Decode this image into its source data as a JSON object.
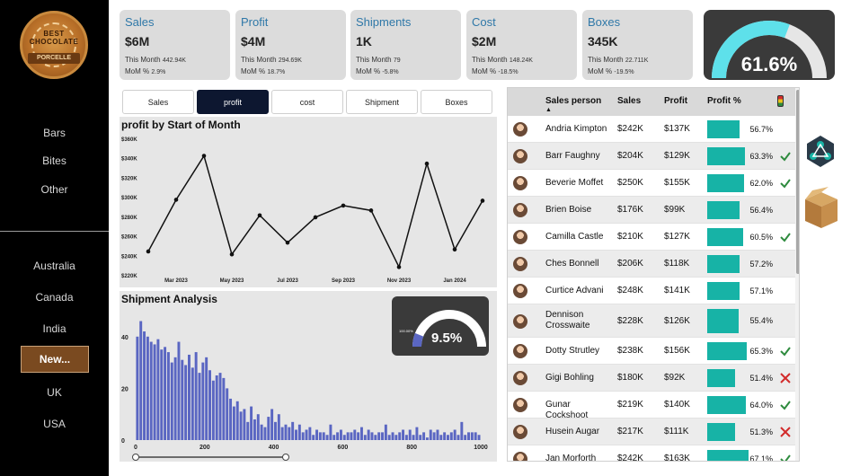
{
  "brand": {
    "logo_top": "BEST CHOCOLATE",
    "logo_name": "PORCELLE"
  },
  "sidebar": {
    "products": [
      "Bars",
      "Bites",
      "Other"
    ],
    "countries": [
      "Australia",
      "Canada",
      "India",
      "New...",
      "UK",
      "USA"
    ]
  },
  "kpis": [
    {
      "title": "Sales",
      "value": "$6M",
      "this_month": "This Month",
      "this_month_val": "442.94K",
      "mom": "MoM %",
      "mom_val": "2.9%"
    },
    {
      "title": "Profit",
      "value": "$4M",
      "this_month": "This Month",
      "this_month_val": "294.69K",
      "mom": "MoM %",
      "mom_val": "18.7%"
    },
    {
      "title": "Shipments",
      "value": "1K",
      "this_month": "This Month",
      "this_month_val": "79",
      "mom": "MoM %",
      "mom_val": "-5.8%"
    },
    {
      "title": "Cost",
      "value": "$2M",
      "this_month": "This Month",
      "this_month_val": "148.24K",
      "mom": "MoM %",
      "mom_val": "-18.5%"
    },
    {
      "title": "Boxes",
      "value": "345K",
      "this_month": "This Month",
      "this_month_val": "22.711K",
      "mom": "MoM %",
      "mom_val": "-19.5%"
    }
  ],
  "gauge_main": {
    "value": "61.6%",
    "fraction": 0.616,
    "color": "#5ee0ea"
  },
  "tabs": [
    "Sales",
    "profit",
    "cost",
    "Shipment",
    "Boxes"
  ],
  "profit_chart": {
    "title": "profit by Start of Month",
    "y_ticks": [
      "$360K",
      "$340K",
      "$320K",
      "$300K",
      "$280K",
      "$260K",
      "$240K",
      "$220K"
    ],
    "x_ticks": [
      "Mar 2023",
      "May 2023",
      "Jul 2023",
      "Sep 2023",
      "Nov 2023",
      "Jan 2024"
    ]
  },
  "shipment_chart": {
    "title": "Shipment Analysis",
    "y_ticks": [
      "40",
      "20",
      "0"
    ],
    "x_ticks": [
      "0",
      "200",
      "400",
      "600",
      "800",
      "1000"
    ],
    "gauge_label": "100.00%",
    "gauge_value": "9.5%",
    "gauge_fraction": 0.095
  },
  "chart_data": [
    {
      "type": "line",
      "title": "profit by Start of Month",
      "x": [
        "2023-02",
        "2023-03",
        "2023-04",
        "2023-05",
        "2023-06",
        "2023-07",
        "2023-08",
        "2023-09",
        "2023-10",
        "2023-11",
        "2023-12",
        "2024-01",
        "2024-02"
      ],
      "values": [
        244,
        297,
        342,
        241,
        281,
        253,
        279,
        291,
        286,
        228,
        334,
        246,
        296
      ],
      "ylim": [
        220,
        360
      ],
      "y_unit": "K$",
      "color": "#111111"
    },
    {
      "type": "bar",
      "title": "Shipment Analysis",
      "x_range": [
        0,
        1000
      ],
      "bin_width": 10,
      "values": [
        40,
        46,
        42,
        40,
        38,
        37,
        39,
        35,
        36,
        34,
        30,
        32,
        38,
        31,
        29,
        33,
        28,
        34,
        26,
        30,
        32,
        27,
        23,
        25,
        26,
        24,
        20,
        16,
        13,
        15,
        11,
        12,
        7,
        13,
        8,
        10,
        6,
        5,
        9,
        12,
        7,
        10,
        5,
        6,
        5,
        7,
        4,
        6,
        3,
        4,
        5,
        2,
        4,
        3,
        3,
        2,
        6,
        2,
        3,
        4,
        2,
        3,
        3,
        4,
        3,
        5,
        2,
        4,
        3,
        2,
        3,
        3,
        6,
        2,
        3,
        2,
        3,
        4,
        2,
        4,
        2,
        5,
        2,
        3,
        1,
        4,
        3,
        4,
        2,
        3,
        2,
        3,
        4,
        2,
        7,
        2,
        3,
        3,
        3,
        2,
        3,
        3,
        2
      ],
      "ylim": [
        0,
        50
      ],
      "color": "#5a66c2"
    }
  ],
  "table": {
    "headers": [
      "Sales person",
      "Sales",
      "Profit",
      "Profit %"
    ],
    "rows": [
      {
        "name": "Andria Kimpton",
        "sales": "$242K",
        "profit": "$137K",
        "pct": "56.7%",
        "frac": 0.567,
        "ind": ""
      },
      {
        "name": "Barr Faughny",
        "sales": "$204K",
        "profit": "$129K",
        "pct": "63.3%",
        "frac": 0.633,
        "ind": "check"
      },
      {
        "name": "Beverie Moffet",
        "sales": "$250K",
        "profit": "$155K",
        "pct": "62.0%",
        "frac": 0.62,
        "ind": "check"
      },
      {
        "name": "Brien Boise",
        "sales": "$176K",
        "profit": "$99K",
        "pct": "56.4%",
        "frac": 0.564,
        "ind": ""
      },
      {
        "name": "Camilla Castle",
        "sales": "$210K",
        "profit": "$127K",
        "pct": "60.5%",
        "frac": 0.605,
        "ind": "check"
      },
      {
        "name": "Ches Bonnell",
        "sales": "$206K",
        "profit": "$118K",
        "pct": "57.2%",
        "frac": 0.572,
        "ind": ""
      },
      {
        "name": "Curtice Advani",
        "sales": "$248K",
        "profit": "$141K",
        "pct": "57.1%",
        "frac": 0.571,
        "ind": ""
      },
      {
        "name": "Dennison Crosswaite",
        "sales": "$228K",
        "profit": "$126K",
        "pct": "55.4%",
        "frac": 0.554,
        "ind": ""
      },
      {
        "name": "Dotty Strutley",
        "sales": "$238K",
        "profit": "$156K",
        "pct": "65.3%",
        "frac": 0.653,
        "ind": "check"
      },
      {
        "name": "Gigi Bohling",
        "sales": "$180K",
        "profit": "$92K",
        "pct": "51.4%",
        "frac": 0.514,
        "ind": "cross"
      },
      {
        "name": "Gunar Cockshoot",
        "sales": "$219K",
        "profit": "$140K",
        "pct": "64.0%",
        "frac": 0.64,
        "ind": "check"
      },
      {
        "name": "Husein Augar",
        "sales": "$217K",
        "profit": "$111K",
        "pct": "51.3%",
        "frac": 0.513,
        "ind": "cross"
      },
      {
        "name": "Jan Morforth",
        "sales": "$242K",
        "profit": "$163K",
        "pct": "67.1%",
        "frac": 0.671,
        "ind": "check"
      }
    ]
  },
  "colors": {
    "accent": "#17b3a6",
    "check": "#2e8b3e",
    "cross": "#d22b2b",
    "title_blue": "#2f78a8"
  },
  "icons": [
    "chart-network-icon",
    "box-icon",
    "check-icon",
    "cross-icon",
    "sort-icon",
    "indicator-icon"
  ]
}
